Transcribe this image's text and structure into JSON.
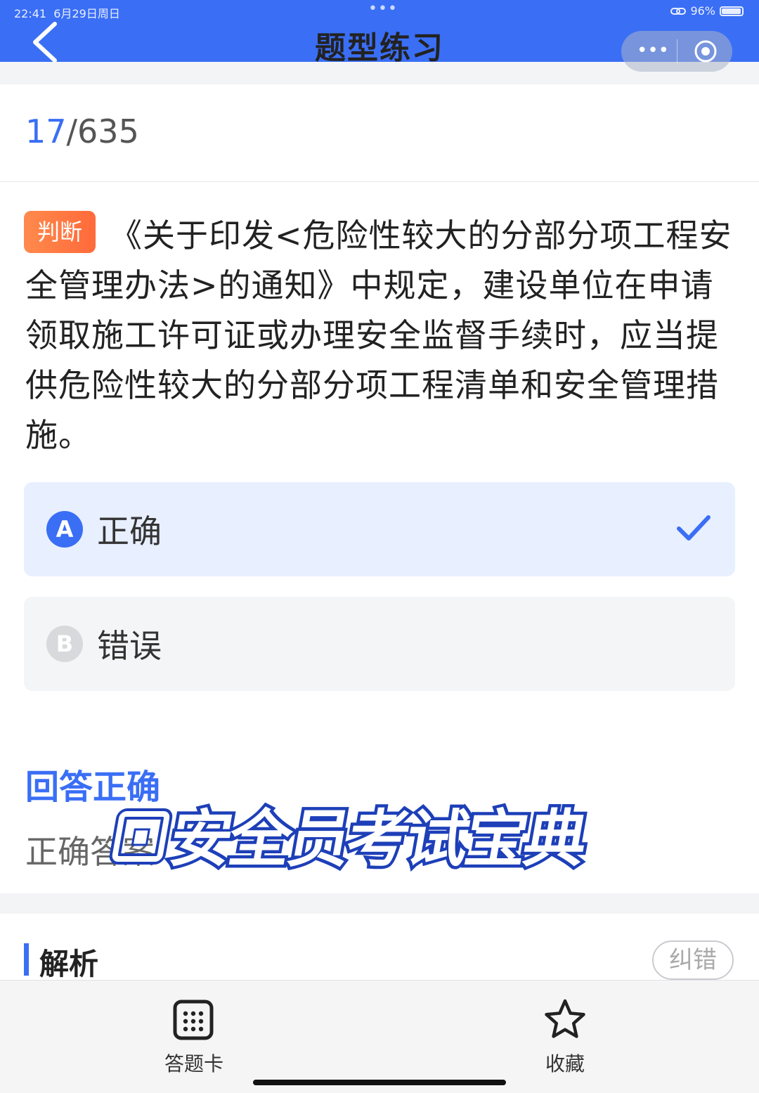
{
  "status_bar": {
    "time": "22:41",
    "date": "6月29日周日",
    "battery_pct": "96%",
    "battery_level": 0.96
  },
  "header": {
    "title": "题型练习",
    "back_icon": "chevron-left-icon",
    "more_icon": "more-dots-icon",
    "close_icon": "target-circle-icon"
  },
  "progress": {
    "current": "17",
    "total": "/635"
  },
  "question": {
    "tag": "判断",
    "text": "《关于印发<危险性较大的分部分项工程安全管理办法>的通知》中规定，建设单位在申请领取施工许可证或办理安全监督手续时，应当提供危险性较大的分部分项工程清单和安全管理措施。"
  },
  "options": [
    {
      "letter": "A",
      "label": "正确",
      "selected": true
    },
    {
      "letter": "B",
      "label": "错误",
      "selected": false
    }
  ],
  "result": {
    "title": "回答正确",
    "answer_text": "正确答案"
  },
  "watermark": {
    "text": "安全员考试宝典"
  },
  "analysis": {
    "title": "解析",
    "report_label": "纠错"
  },
  "bottom_bar": {
    "card_label": "答题卡",
    "fav_label": "收藏"
  },
  "colors": {
    "primary": "#3a6ef5",
    "tag": "#ff7a45"
  }
}
